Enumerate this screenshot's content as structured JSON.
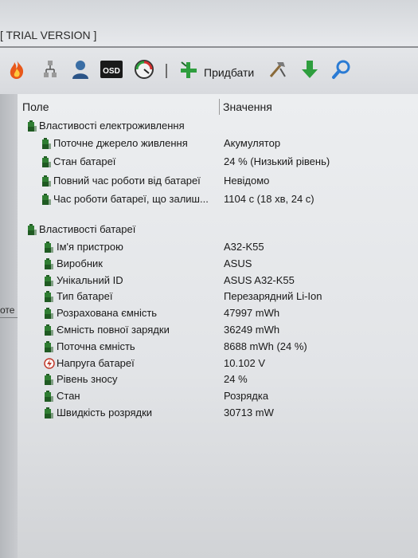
{
  "window": {
    "title": "[ TRIAL VERSION ]"
  },
  "toolbar": {
    "buttons": [
      {
        "icon": "fire-icon",
        "color": "#e8581a"
      },
      {
        "icon": "tree-branch-icon",
        "color": "#6b6b6b"
      },
      {
        "icon": "user-icon",
        "color": "#3a6ea5"
      },
      {
        "icon": "osd-icon",
        "label": "OSD",
        "color": "#c62828"
      },
      {
        "icon": "gauge-icon",
        "color": "#d32f2f"
      },
      {
        "icon": "add-icon",
        "color": "#2e9e3e"
      },
      {
        "icon": "tools-icon",
        "color": "#7a7a7a"
      },
      {
        "icon": "download-arrow-icon",
        "color": "#2e9e3e"
      },
      {
        "icon": "search-icon",
        "color": "#2a7bd4"
      }
    ],
    "add_label": "Придбати"
  },
  "sidebar": {
    "text": "оте"
  },
  "columns": {
    "field": "Поле",
    "value": "Значення"
  },
  "groups": [
    {
      "title": "Властивості електроживлення",
      "items": [
        {
          "name": "Поточне джерело живлення",
          "value": "Акумулятор"
        },
        {
          "name": "Стан батареї",
          "value": "24 % (Низький рівень)"
        },
        {
          "name": "Повний час роботи від батареї",
          "value": "Невідомо"
        },
        {
          "name": "Час роботи батареї, що залиш...",
          "value": "1104 с (18 хв, 24 с)"
        }
      ]
    },
    {
      "title": "Властивості батареї",
      "items": [
        {
          "name": "Ім'я пристрою",
          "value": "A32-K55"
        },
        {
          "name": "Виробник",
          "value": "ASUS"
        },
        {
          "name": "Унікальний ID",
          "value": "ASUS A32-K55"
        },
        {
          "name": "Тип батареї",
          "value": "Перезарядний Li-Ion"
        },
        {
          "name": "Розрахована ємність",
          "value": "47997 mWh"
        },
        {
          "name": "Ємність повної зарядки",
          "value": "36249 mWh"
        },
        {
          "name": "Поточна ємність",
          "value": "8688 mWh  (24 %)"
        },
        {
          "name": "Напруга батареї",
          "value": "10.102 V",
          "icon": "voltage-icon"
        },
        {
          "name": "Рівень зносу",
          "value": "24 %"
        },
        {
          "name": "Стан",
          "value": "Розрядка"
        },
        {
          "name": "Швидкість розрядки",
          "value": "30713 mW"
        }
      ]
    }
  ],
  "colors": {
    "battery_icon": "#2f7d32",
    "battery_icon_dark": "#1f5a22",
    "voltage_icon": "#c0392b"
  }
}
